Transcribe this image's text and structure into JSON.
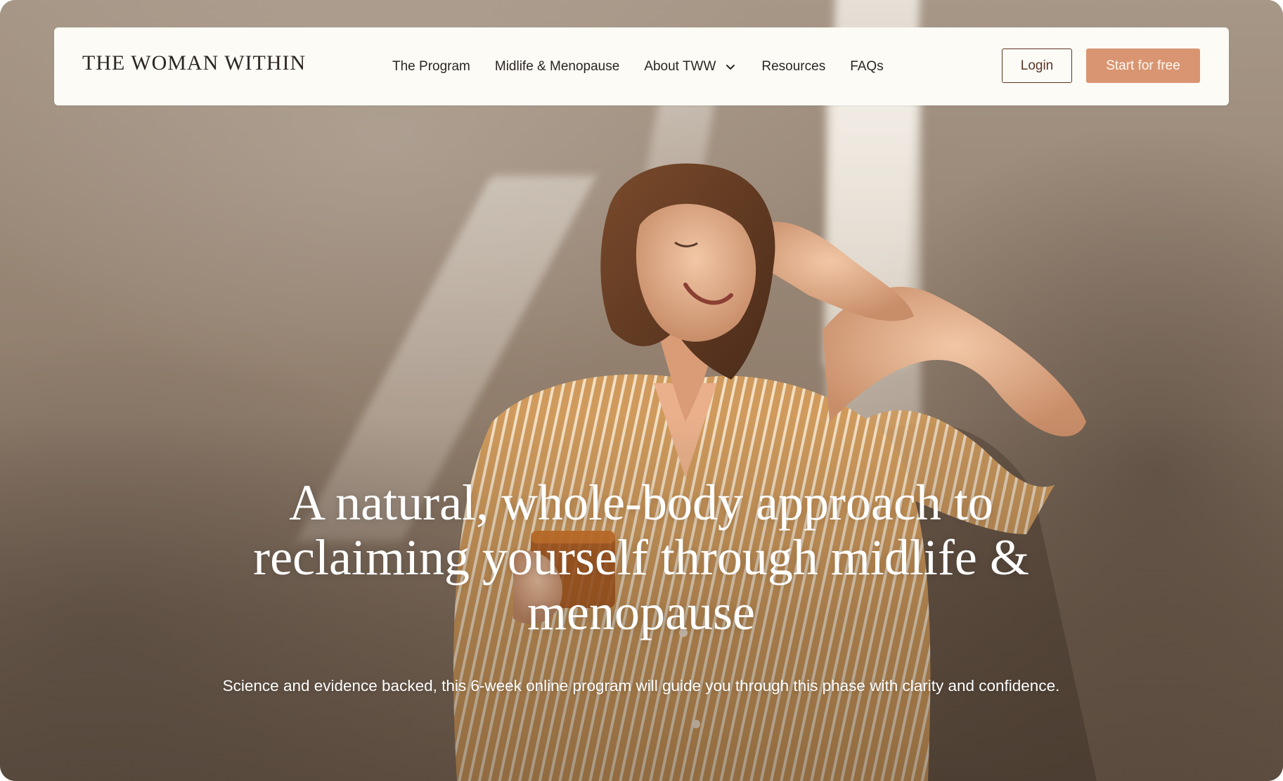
{
  "brand": {
    "logo_text": "THE WOMAN WITHIN"
  },
  "nav": {
    "items": [
      {
        "label": "The Program"
      },
      {
        "label": "Midlife & Menopause"
      },
      {
        "label": "About TWW",
        "has_dropdown": true
      },
      {
        "label": "Resources"
      },
      {
        "label": "FAQs"
      }
    ],
    "login_label": "Login",
    "cta_label": "Start for free"
  },
  "hero": {
    "title": "A natural, whole-body approach to reclaiming yourself through midlife & menopause",
    "subtitle": "Science and evidence backed, this 6-week online program will guide you through this phase with clarity and confidence.",
    "image_alt": "Smiling woman in a striped shirt shielding her eyes from sunlight while holding a cup of tea"
  },
  "colors": {
    "nav_background": "#fdfbf6",
    "cta_background": "#d99572",
    "login_border": "#5b3526",
    "text_dark": "#2b2522",
    "hero_text": "#ffffff"
  }
}
